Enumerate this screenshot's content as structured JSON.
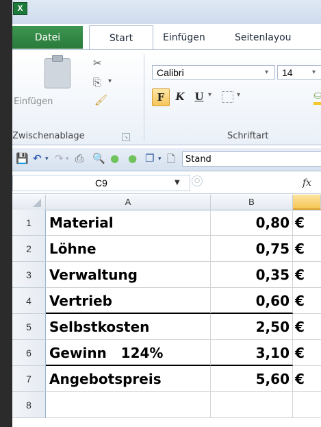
{
  "tabs": {
    "file": "Datei",
    "start": "Start",
    "insert": "Einfügen",
    "page_layout": "Seitenlayou"
  },
  "ribbon": {
    "paste_label": "Einfügen",
    "clipboard_group": "Zwischenablage",
    "font_name": "Calibri",
    "font_size": "14",
    "bold": "F",
    "italic": "K",
    "underline": "U",
    "font_group": "Schriftart"
  },
  "qat": {
    "style_value": "Stand"
  },
  "formula_bar": {
    "name_box": "C9",
    "fx": "fx"
  },
  "columns": [
    "A",
    "B"
  ],
  "rows": [
    {
      "num": "1",
      "label": "Material",
      "value": "0,80",
      "currency": "€"
    },
    {
      "num": "2",
      "label": "Löhne",
      "value": "0,75",
      "currency": "€"
    },
    {
      "num": "3",
      "label": "Verwaltung",
      "value": "0,35",
      "currency": "€"
    },
    {
      "num": "4",
      "label": "Vertrieb",
      "value": "0,60",
      "currency": "€"
    },
    {
      "num": "5",
      "label": "Selbstkosten",
      "value": "2,50",
      "currency": "€"
    },
    {
      "num": "6",
      "label": "Gewinn   124%",
      "value": "3,10",
      "currency": "€"
    },
    {
      "num": "7",
      "label": "Angebotspreis",
      "value": "5,60",
      "currency": "€"
    },
    {
      "num": "8",
      "label": "",
      "value": "",
      "currency": ""
    }
  ]
}
